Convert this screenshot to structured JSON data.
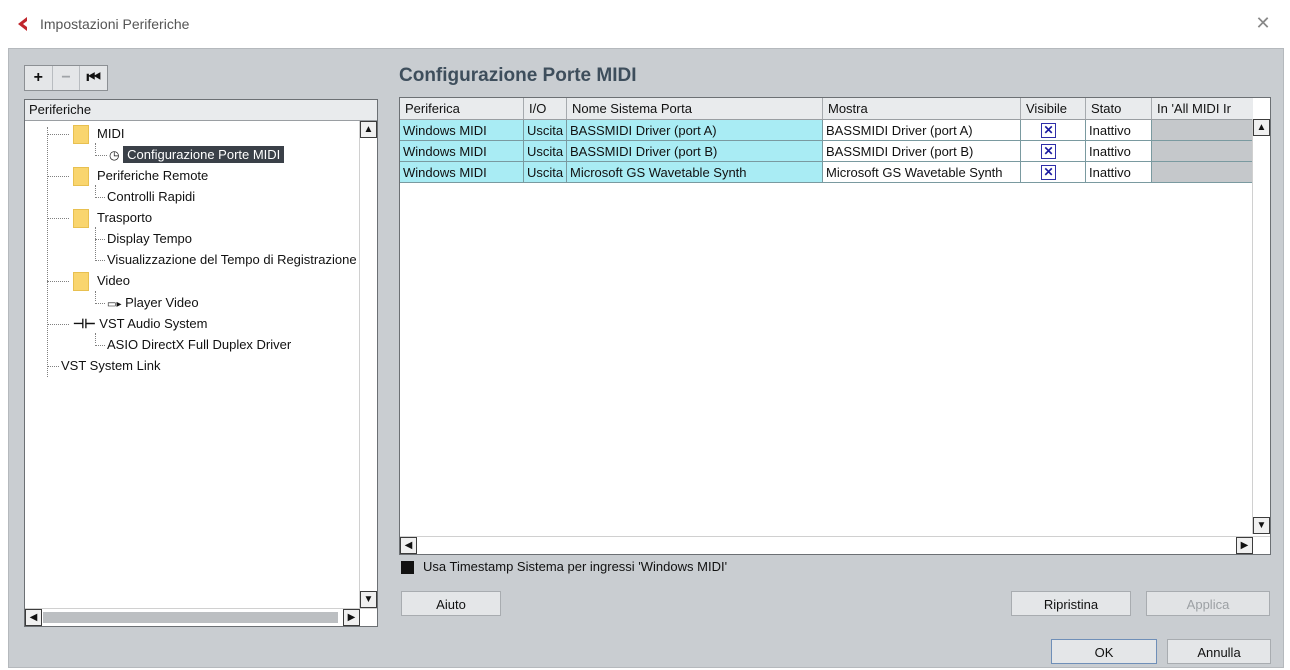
{
  "window": {
    "title": "Impostazioni Periferiche",
    "close_glyph": "✕"
  },
  "toolbar": {
    "add_label": "+",
    "remove_label": "−",
    "reset_label": "⏮"
  },
  "tree": {
    "header": "Periferiche",
    "items": [
      {
        "label": "MIDI",
        "icon": "folder-icon",
        "level": 0
      },
      {
        "label": "Configurazione Porte MIDI",
        "icon": "clock-icon",
        "level": 1,
        "selected": true
      },
      {
        "label": "Periferiche Remote",
        "icon": "folder-icon",
        "level": 0
      },
      {
        "label": "Controlli Rapidi",
        "icon": "",
        "level": 1
      },
      {
        "label": "Trasporto",
        "icon": "folder-icon",
        "level": 0
      },
      {
        "label": "Display Tempo",
        "icon": "",
        "level": 1
      },
      {
        "label": "Visualizzazione del Tempo di Registrazione",
        "icon": "",
        "level": 1
      },
      {
        "label": "Video",
        "icon": "folder-icon",
        "level": 0
      },
      {
        "label": "Player Video",
        "icon": "video-player-icon",
        "level": 1
      },
      {
        "label": "VST Audio System",
        "icon": "audio-system-icon",
        "level": 0
      },
      {
        "label": "ASIO DirectX Full Duplex Driver",
        "icon": "",
        "level": 1
      },
      {
        "label": "VST System Link",
        "icon": "",
        "level": 0
      }
    ]
  },
  "main": {
    "section_title": "Configurazione Porte MIDI",
    "table": {
      "columns": [
        "Periferica",
        "I/O",
        "Nome Sistema Porta",
        "Mostra",
        "Visibile",
        "Stato",
        "In 'All MIDI Ir"
      ],
      "rows": [
        {
          "periferica": "Windows MIDI",
          "io": "Uscita",
          "nome": "BASSMIDI Driver (port A)",
          "mostra": "BASSMIDI Driver (port A)",
          "visibile": true,
          "stato": "Inattivo"
        },
        {
          "periferica": "Windows MIDI",
          "io": "Uscita",
          "nome": "BASSMIDI Driver (port B)",
          "mostra": "BASSMIDI Driver (port B)",
          "visibile": true,
          "stato": "Inattivo"
        },
        {
          "periferica": "Windows MIDI",
          "io": "Uscita",
          "nome": "Microsoft GS Wavetable Synth",
          "mostra": "Microsoft GS Wavetable Synth",
          "visibile": true,
          "stato": "Inattivo"
        }
      ]
    },
    "timestamp_option": {
      "label": "Usa Timestamp Sistema per ingressi 'Windows MIDI'",
      "checked": true
    }
  },
  "buttons": {
    "help": "Aiuto",
    "reset": "Ripristina",
    "apply": "Applica",
    "ok": "OK",
    "cancel": "Annulla"
  },
  "colors": {
    "accent_title": "#3e4e5c",
    "row_highlight": "#a9ecf4",
    "logo_red": "#c0262c"
  }
}
